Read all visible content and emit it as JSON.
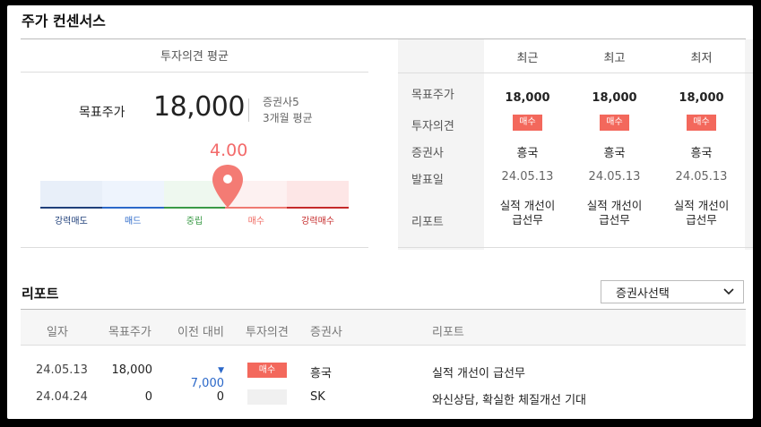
{
  "title": "주가 컨센서스",
  "average": {
    "header": "투자의견 평균",
    "target_label": "목표주가",
    "target_value": "18,000",
    "broker_count": "증권사5",
    "period": "3개월 평균",
    "score": "4.00",
    "score_level": 4.0,
    "gauge_labels": [
      "강력매도",
      "매드",
      "중립",
      "매수",
      "강력매수"
    ]
  },
  "recent_table": {
    "columns": [
      "최근",
      "최고",
      "최저"
    ],
    "row_labels": [
      "목표주가",
      "투자의견",
      "증권사",
      "발표일",
      "리포트"
    ],
    "cells": [
      {
        "target": "18,000",
        "opinion": "매수",
        "broker": "흥국",
        "date": "24.05.13",
        "report_l1": "실적 개선이",
        "report_l2": "급선무"
      },
      {
        "target": "18,000",
        "opinion": "매수",
        "broker": "흥국",
        "date": "24.05.13",
        "report_l1": "실적 개선이",
        "report_l2": "급선무"
      },
      {
        "target": "18,000",
        "opinion": "매수",
        "broker": "흥국",
        "date": "24.05.13",
        "report_l1": "실적 개선이",
        "report_l2": "급선무"
      }
    ]
  },
  "reports": {
    "title": "리포트",
    "select_label": "증권사선택",
    "headers": [
      "일자",
      "목표주가",
      "이전 대비",
      "투자의견",
      "증권사",
      "리포트"
    ],
    "rows": [
      {
        "date": "24.05.13",
        "target": "18,000",
        "change": "7,000",
        "change_dir": "down",
        "opinion": "매수",
        "broker": "흥국",
        "report": "실적 개선이 급선무"
      },
      {
        "date": "24.04.24",
        "target": "0",
        "change": "0",
        "change_dir": "none",
        "opinion": "",
        "broker": "SK",
        "report": "와신상담, 확실한 체질개선 기대"
      }
    ]
  },
  "colors": {
    "accent_red": "#f3685c",
    "down_blue": "#2b68c9"
  }
}
